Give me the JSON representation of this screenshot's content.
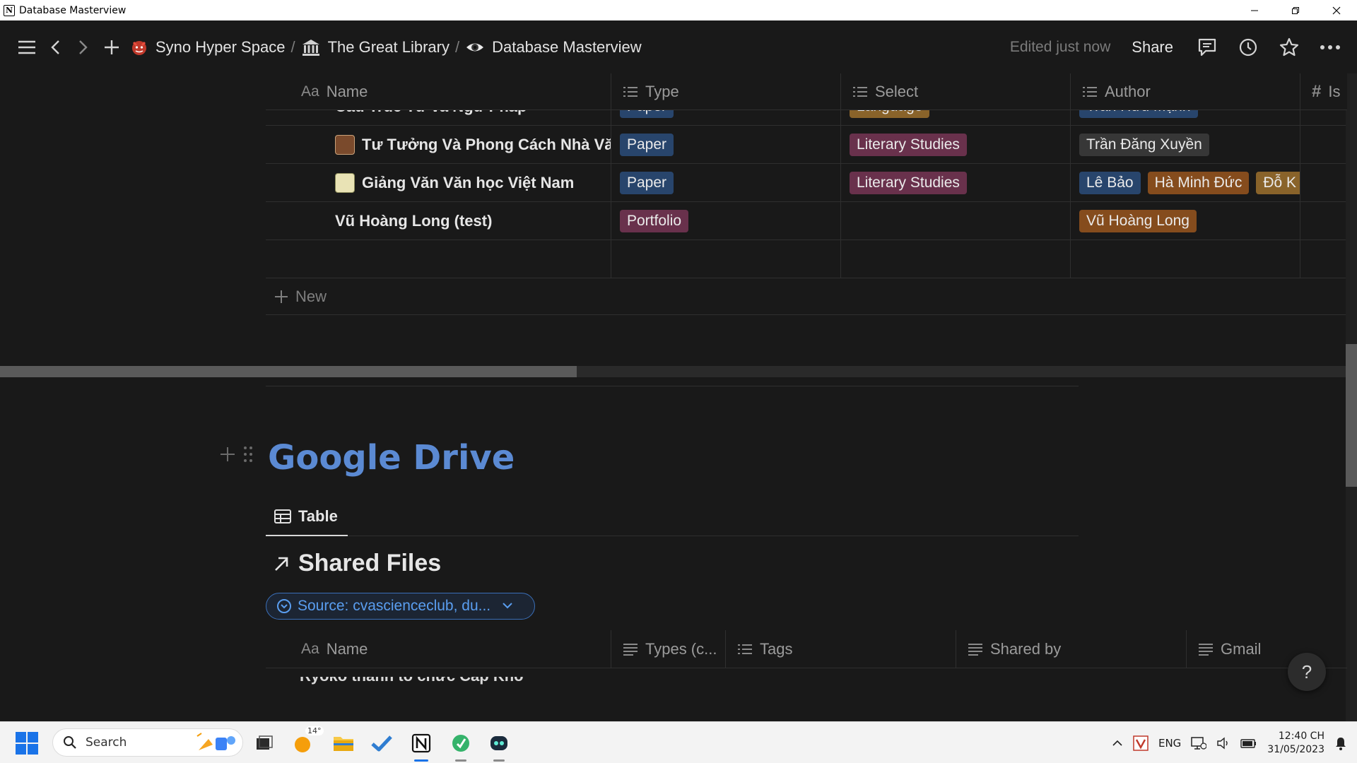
{
  "window": {
    "title": "Database Masterview",
    "app_icon": "N",
    "controls": [
      "minimize",
      "restore",
      "close"
    ]
  },
  "topbar": {
    "breadcrumbs": [
      {
        "icon": "devil-emoji",
        "label": "Syno Hyper Space"
      },
      {
        "icon": "library-icon",
        "label": "The Great Library"
      },
      {
        "icon": "eye-icon",
        "label": "Database Masterview"
      }
    ],
    "separator": "/",
    "edited": "Edited just now",
    "share": "Share"
  },
  "table1": {
    "columns": [
      {
        "icon": "text-icon",
        "label": "Name"
      },
      {
        "icon": "list-icon",
        "label": "Type"
      },
      {
        "icon": "list-icon",
        "label": "Select"
      },
      {
        "icon": "list-icon",
        "label": "Author"
      },
      {
        "icon": "hash-icon",
        "label": "Is"
      }
    ],
    "rows": [
      {
        "name": "Cấu Trúc Từ và Ngữ Pháp",
        "type": "Paper",
        "select": "Language",
        "authors": [
          "Trần Hữu Mạnh"
        ]
      },
      {
        "name": "Tư Tưởng Và Phong Cách Nhà Vă",
        "type": "Paper",
        "select": "Literary Studies",
        "authors": [
          "Trần Đăng Xuyền"
        ]
      },
      {
        "name": "Giảng Văn Văn học Việt Nam",
        "type": "Paper",
        "select": "Literary Studies",
        "authors": [
          "Lê Bảo",
          "Hà Minh Đức",
          "Đỗ K"
        ]
      },
      {
        "name": "Vũ Hoàng Long (test)",
        "type": "Portfolio",
        "select": "",
        "authors": [
          "Vũ Hoàng Long"
        ]
      }
    ],
    "new_label": "New",
    "colors": {
      "blue": "#28456c",
      "pink": "#69314c",
      "gold": "#89632a",
      "orange": "#854c1d",
      "gray": "#373737"
    }
  },
  "google_drive": {
    "title": "Google Drive",
    "tab_label": "Table",
    "linked_title": "Shared Files",
    "filter": "Source: cvascienceclub, du...",
    "columns": [
      {
        "icon": "text-icon",
        "label": "Name"
      },
      {
        "icon": "lines-icon",
        "label": "Types (c..."
      },
      {
        "icon": "list-icon",
        "label": "Tags"
      },
      {
        "icon": "lines-icon",
        "label": "Shared by"
      },
      {
        "icon": "lines-icon",
        "label": "Gmail"
      }
    ],
    "peek_row": "Ryokó thành tổ chức Cấp Khó"
  },
  "help": "?",
  "taskbar": {
    "search_placeholder": "Search",
    "weather_temp": "14°",
    "apps": [
      "task-view",
      "weather",
      "file-explorer",
      "todo",
      "notion",
      "evernote-like",
      "sync-app"
    ],
    "tray": {
      "language": "ENG",
      "time": "12:40 CH",
      "date": "31/05/2023"
    }
  }
}
